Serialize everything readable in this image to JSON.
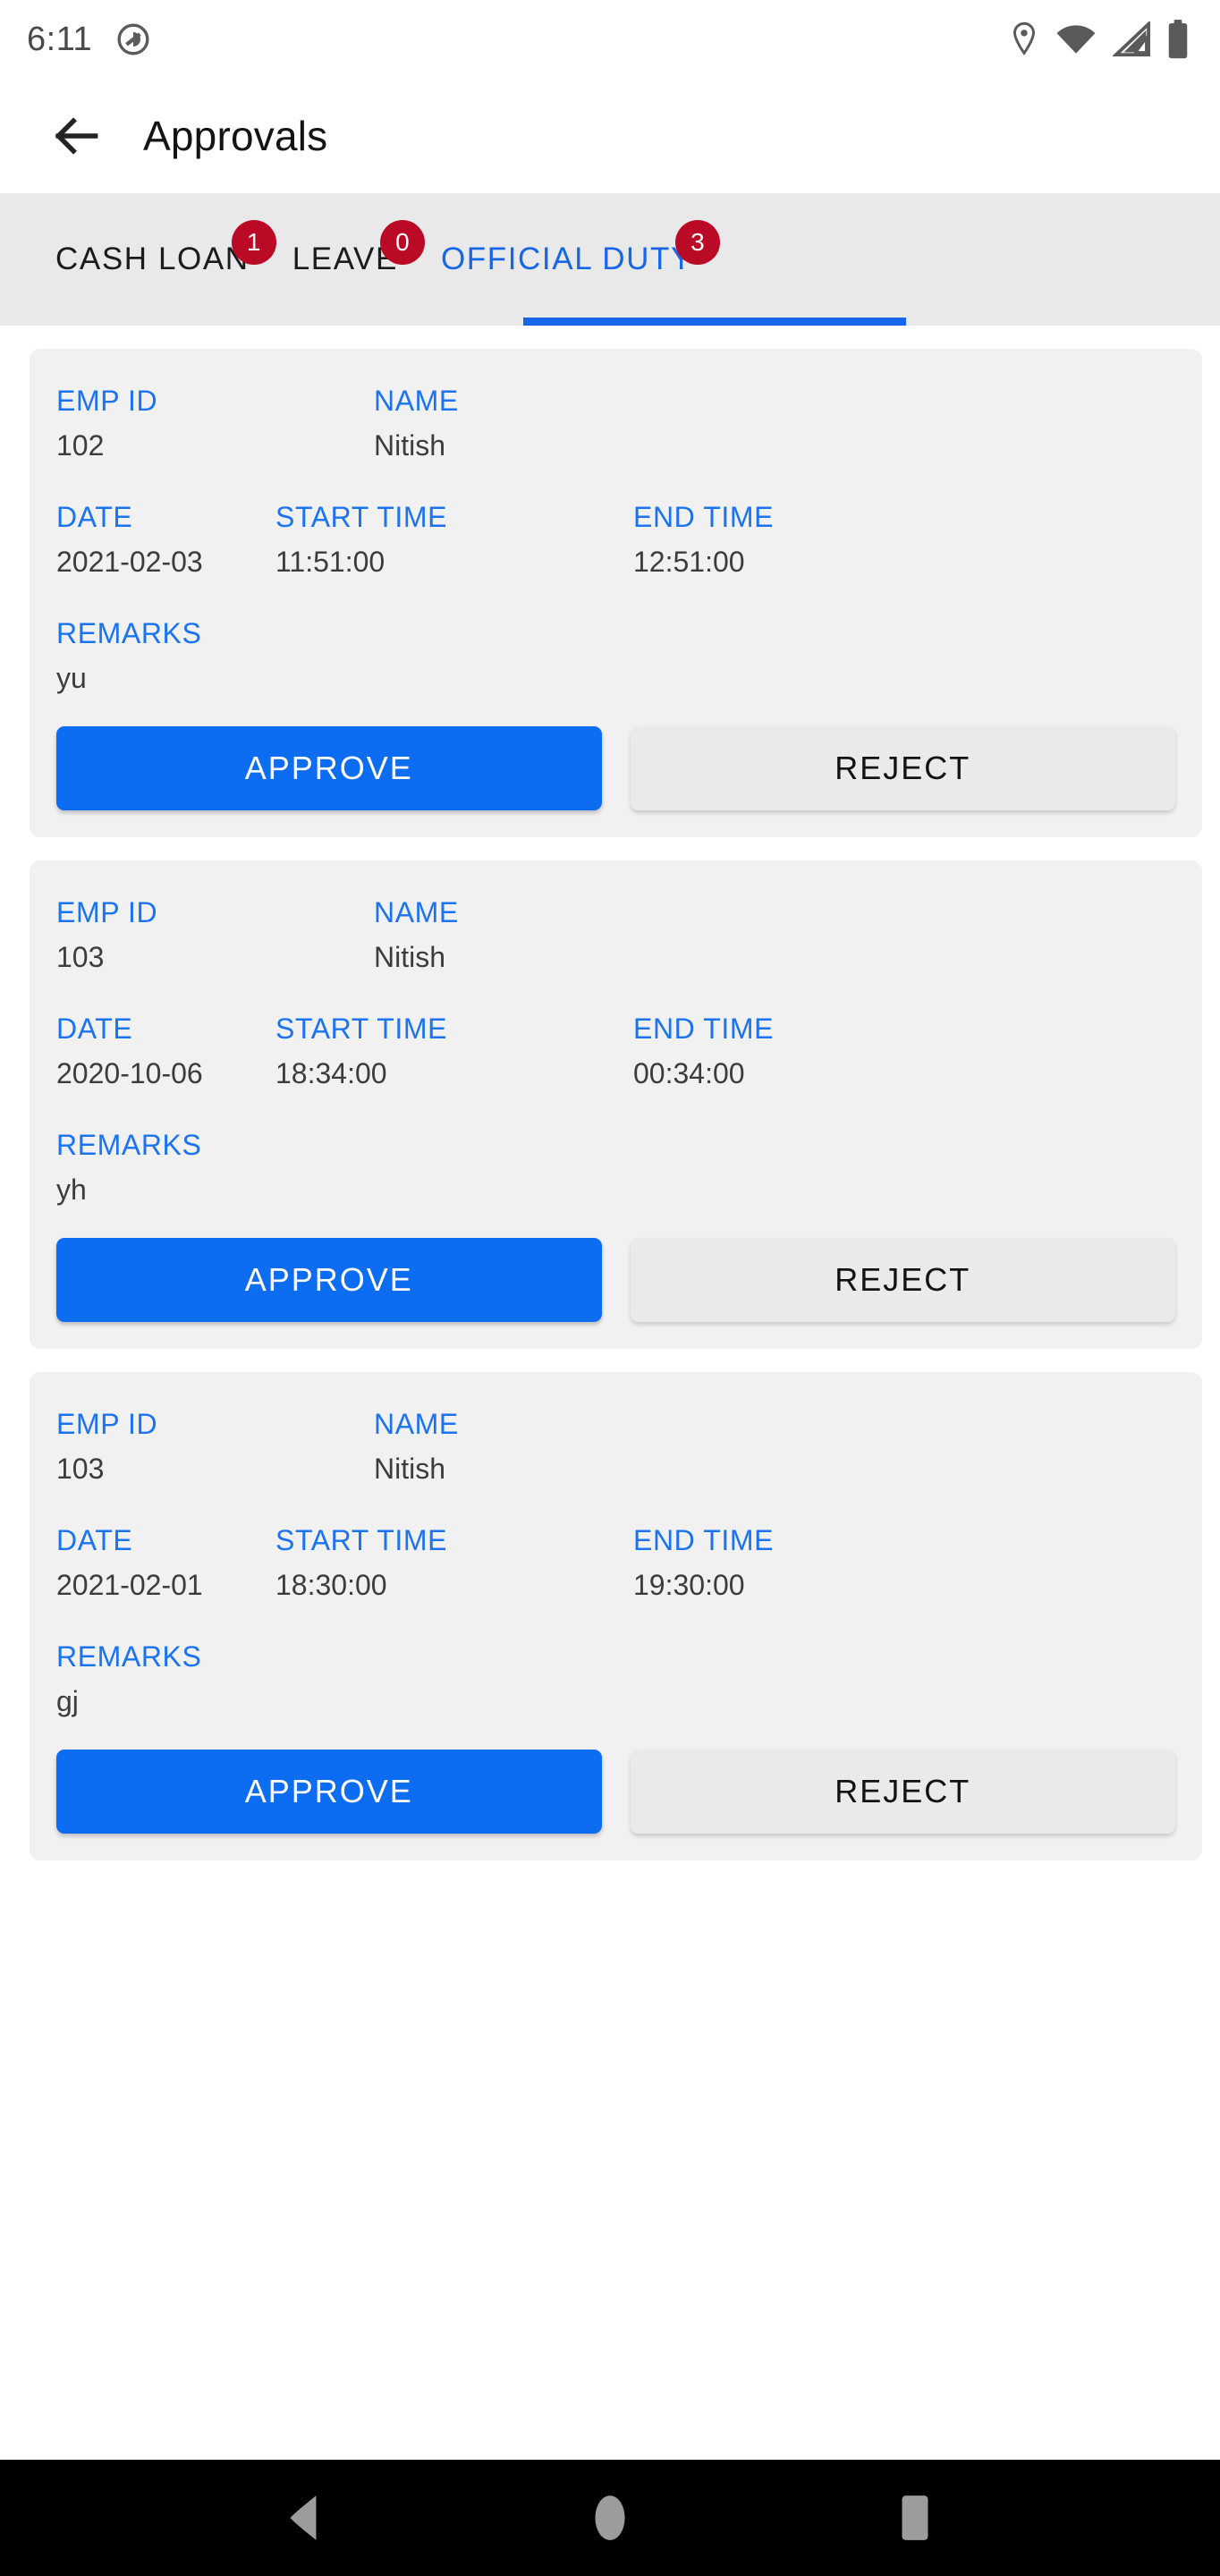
{
  "status_bar": {
    "time": "6:11",
    "left_icons": [
      "notification-circle-icon"
    ],
    "right_icons": [
      "location-pin-icon",
      "wifi-icon",
      "cellular-signal-icon",
      "battery-icon"
    ]
  },
  "app_bar": {
    "back_icon": "back-arrow-icon",
    "title": "Approvals"
  },
  "tabs": [
    {
      "label": "CASH LOAN",
      "badge": "1",
      "active": false
    },
    {
      "label": "LEAVE",
      "badge": "0",
      "active": false
    },
    {
      "label": "OFFICIAL DUTY",
      "badge": "3",
      "active": true
    }
  ],
  "field_labels": {
    "emp_id": "EMP ID",
    "name": "NAME",
    "date": "DATE",
    "start_time": "START TIME",
    "end_time": "END TIME",
    "remarks": "REMARKS"
  },
  "actions": {
    "approve": "APPROVE",
    "reject": "REJECT"
  },
  "cards": [
    {
      "emp_id": "102",
      "name": "Nitish",
      "date": "2021-02-03",
      "start_time": "11:51:00",
      "end_time": "12:51:00",
      "remarks": "yu"
    },
    {
      "emp_id": "103",
      "name": "Nitish",
      "date": "2020-10-06",
      "start_time": "18:34:00",
      "end_time": "00:34:00",
      "remarks": "yh"
    },
    {
      "emp_id": "103",
      "name": "Nitish",
      "date": "2021-02-01",
      "start_time": "18:30:00",
      "end_time": "19:30:00",
      "remarks": "gj"
    }
  ],
  "nav_bar": {
    "back": "nav-back-icon",
    "home": "nav-home-icon",
    "recents": "nav-recents-icon"
  },
  "colors": {
    "accent_blue": "#1567e8",
    "label_blue": "#1a73f0",
    "badge_red": "#bb0a26",
    "card_bg": "#f1f1f1",
    "tab_bg": "#e9e9e9"
  }
}
